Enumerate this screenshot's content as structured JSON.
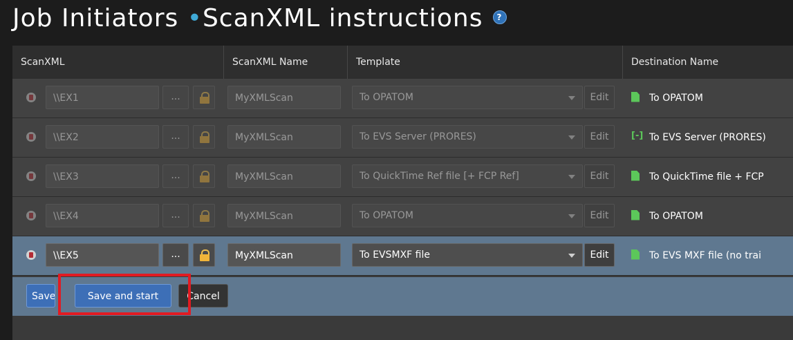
{
  "page": {
    "title_part1": "Job Initiators",
    "title_part2": "ScanXML instructions",
    "help_glyph": "?"
  },
  "table": {
    "headers": {
      "scanxml": "ScanXML",
      "scanxml_name": "ScanXML Name",
      "template": "Template",
      "destination_name": "Destination Name"
    },
    "rows": [
      {
        "path": "\\\\EX1",
        "name": "MyXMLScan",
        "template": "To OPATOM",
        "edit": "Edit",
        "destination": "To OPATOM",
        "dest_icon": "file-icon"
      },
      {
        "path": "\\\\EX2",
        "name": "MyXMLScan",
        "template": "To EVS Server  (PRORES)",
        "edit": "Edit",
        "destination": "To EVS Server  (PRORES)",
        "dest_icon": "bracket-icon"
      },
      {
        "path": "\\\\EX3",
        "name": "MyXMLScan",
        "template": "To QuickTime Ref file [+ FCP Ref]",
        "edit": "Edit",
        "destination": "To QuickTime file + FCP",
        "dest_icon": "file-icon"
      },
      {
        "path": "\\\\EX4",
        "name": "MyXMLScan",
        "template": "To OPATOM",
        "edit": "Edit",
        "destination": "To OPATOM",
        "dest_icon": "file-icon"
      },
      {
        "path": "\\\\EX5",
        "name": "MyXMLScan",
        "template": "To EVSMXF file",
        "edit": "Edit",
        "destination": "To EVS MXF file (no trai",
        "dest_icon": "file-icon"
      }
    ],
    "browse_label": "...",
    "bracket_glyph": "[-]"
  },
  "actions": {
    "save": "Save",
    "save_and_start": "Save and start",
    "cancel": "Cancel"
  },
  "colors": {
    "accent": "#3fa9d6",
    "active_row": "#5f7890",
    "highlight": "#e11b22",
    "primary_button": "#3d6fb7"
  }
}
